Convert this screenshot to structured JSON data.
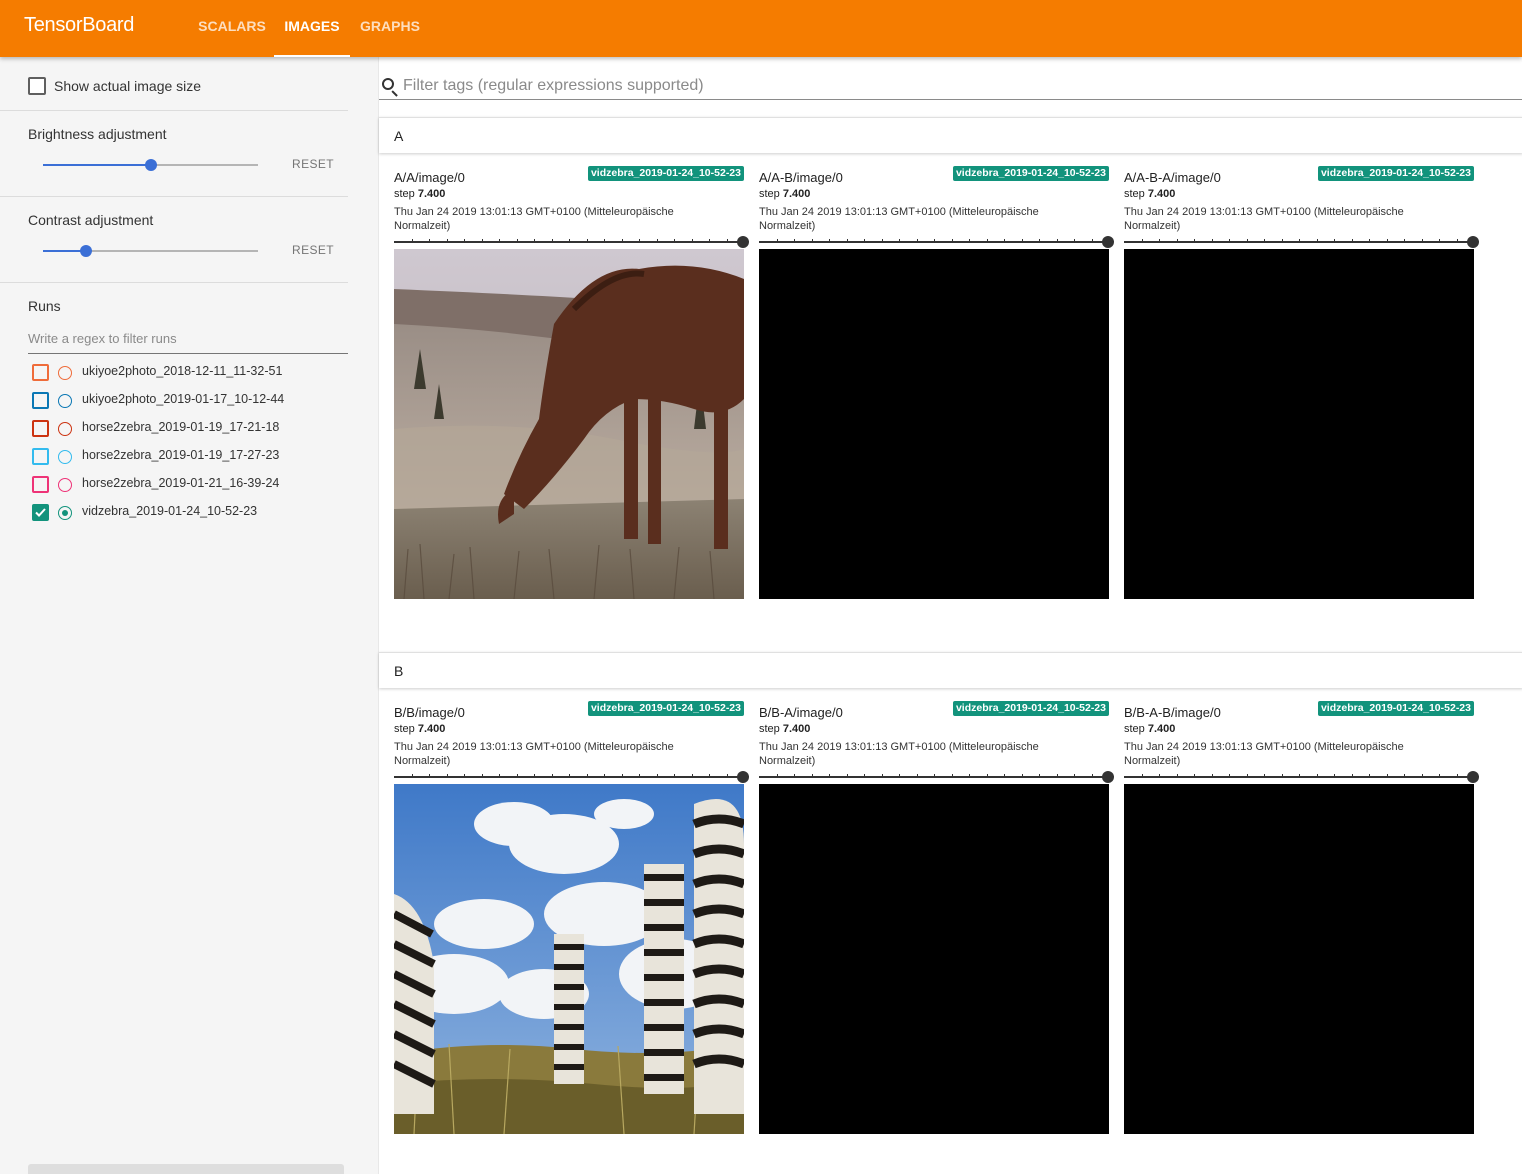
{
  "app": {
    "title": "TensorBoard",
    "tabs": [
      {
        "label": "SCALARS",
        "active": false
      },
      {
        "label": "IMAGES",
        "active": true
      },
      {
        "label": "GRAPHS",
        "active": false
      }
    ],
    "accent_color": "#f57c00"
  },
  "sidebar": {
    "show_actual_size_label": "Show actual image size",
    "show_actual_size_checked": false,
    "brightness": {
      "label": "Brightness adjustment",
      "reset": "RESET",
      "value": 0.5
    },
    "contrast": {
      "label": "Contrast adjustment",
      "reset": "RESET",
      "value": 0.2
    },
    "runs": {
      "title": "Runs",
      "filter_placeholder": "Write a regex to filter runs",
      "items": [
        {
          "name": "ukiyoe2photo_2018-12-11_11-32-51",
          "color": "#ef6c3a",
          "checked": false
        },
        {
          "name": "ukiyoe2photo_2019-01-17_10-12-44",
          "color": "#0a77b4",
          "checked": false
        },
        {
          "name": "horse2zebra_2019-01-19_17-21-18",
          "color": "#cc3311",
          "checked": false
        },
        {
          "name": "horse2zebra_2019-01-19_17-27-23",
          "color": "#33bbee",
          "checked": false
        },
        {
          "name": "horse2zebra_2019-01-21_16-39-24",
          "color": "#ee3377",
          "checked": false
        },
        {
          "name": "vidzebra_2019-01-24_10-52-23",
          "color": "#12937c",
          "checked": true
        }
      ]
    }
  },
  "main": {
    "filter_placeholder": "Filter tags (regular expressions supported)",
    "sections": [
      {
        "title": "A",
        "cards": [
          {
            "tag": "A/A/image/0",
            "run": "vidzebra_2019-01-24_10-52-23",
            "step_label": "step",
            "step": "7.400",
            "time": "Thu Jan 24 2019 13:01:13 GMT+0100 (Mitteleuropäische Normalzeit)",
            "image": "horse-grazing-photo"
          },
          {
            "tag": "A/A-B/image/0",
            "run": "vidzebra_2019-01-24_10-52-23",
            "step_label": "step",
            "step": "7.400",
            "time": "Thu Jan 24 2019 13:01:13 GMT+0100 (Mitteleuropäische Normalzeit)",
            "image": "black"
          },
          {
            "tag": "A/A-B-A/image/0",
            "run": "vidzebra_2019-01-24_10-52-23",
            "step_label": "step",
            "step": "7.400",
            "time": "Thu Jan 24 2019 13:01:13 GMT+0100 (Mitteleuropäische Normalzeit)",
            "image": "black"
          }
        ]
      },
      {
        "title": "B",
        "cards": [
          {
            "tag": "B/B/image/0",
            "run": "vidzebra_2019-01-24_10-52-23",
            "step_label": "step",
            "step": "7.400",
            "time": "Thu Jan 24 2019 13:01:13 GMT+0100 (Mitteleuropäische Normalzeit)",
            "image": "zebras-sky-photo"
          },
          {
            "tag": "B/B-A/image/0",
            "run": "vidzebra_2019-01-24_10-52-23",
            "step_label": "step",
            "step": "7.400",
            "time": "Thu Jan 24 2019 13:01:13 GMT+0100 (Mitteleuropäische Normalzeit)",
            "image": "black"
          },
          {
            "tag": "B/B-A-B/image/0",
            "run": "vidzebra_2019-01-24_10-52-23",
            "step_label": "step",
            "step": "7.400",
            "time": "Thu Jan 24 2019 13:01:13 GMT+0100 (Mitteleuropäische Normalzeit)",
            "image": "black"
          }
        ]
      }
    ]
  }
}
